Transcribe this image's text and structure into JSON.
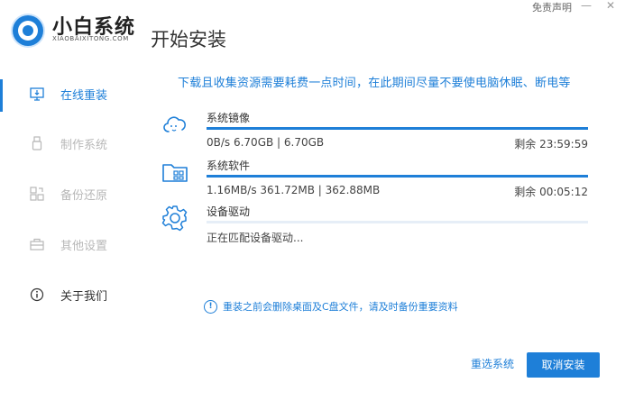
{
  "header": {
    "logo_name": "小白系统",
    "logo_sub": "XIAOBAIXITONG.COM",
    "page_title": "开始安装",
    "disclaimer": "免责声明",
    "minimize_glyph": "—",
    "close_glyph": "✕"
  },
  "sidebar": {
    "items": [
      {
        "label": "在线重装",
        "icon": "monitor-icon",
        "active": true
      },
      {
        "label": "制作系统",
        "icon": "usb-icon",
        "active": false
      },
      {
        "label": "备份还原",
        "icon": "backup-icon",
        "active": false
      },
      {
        "label": "其他设置",
        "icon": "toolbox-icon",
        "active": false
      },
      {
        "label": "关于我们",
        "icon": "info-icon",
        "active": false
      }
    ]
  },
  "main": {
    "notice": "下载且收集资源需要耗费一点时间，在此期间尽量不要使电脑休眠、断电等",
    "tasks": [
      {
        "name": "系统镜像",
        "status": "0B/s 6.70GB | 6.70GB",
        "remaining": "剩余 23:59:59",
        "progress": 1.0,
        "icon": "cloud-download-icon"
      },
      {
        "name": "系统软件",
        "status": "1.16MB/s 361.72MB | 362.88MB",
        "remaining": "剩余 00:05:12",
        "progress": 1.0,
        "icon": "folder-apps-icon"
      },
      {
        "name": "设备驱动",
        "status": "正在匹配设备驱动...",
        "remaining": "",
        "progress": 0.0,
        "icon": "gear-icon"
      }
    ],
    "warning_glyph": "!",
    "warning": "重装之前会删除桌面及C盘文件，请及时备份重要资料"
  },
  "footer": {
    "reselect_label": "重选系统",
    "cancel_label": "取消安装"
  },
  "colors": {
    "accent": "#1e7fd8",
    "track": "#e6eef7",
    "muted": "#b8b8b8"
  }
}
